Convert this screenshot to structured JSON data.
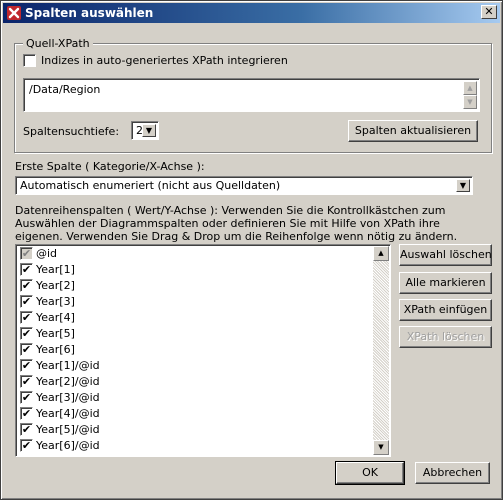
{
  "window": {
    "title": "Spalten auswählen",
    "close_glyph": "✕"
  },
  "source_group": {
    "legend": "Quell-XPath",
    "integrate_indices_label": "Indizes in auto-generiertes XPath integrieren",
    "integrate_indices_checked": false,
    "xpath_value": "/Data/Region",
    "depth_label": "Spaltensuchtiefe:",
    "depth_value": "2",
    "refresh_button": "Spalten aktualisieren"
  },
  "first_column": {
    "label": "Erste Spalte ( Kategorie/X-Achse ):",
    "selected": "Automatisch enumeriert (nicht aus Quelldaten)"
  },
  "series": {
    "description": "Datenreihenspalten ( Wert/Y-Achse ): Verwenden Sie die Kontrollkästchen zum Auswählen der Diagrammspalten oder definieren Sie mit Hilfe von XPath ihre eigenen. Verwenden Sie Drag & Drop um die Reihenfolge wenn nötig zu ändern.",
    "items": [
      {
        "label": "@id",
        "checked": true,
        "disabled": true
      },
      {
        "label": "Year[1]",
        "checked": true
      },
      {
        "label": "Year[2]",
        "checked": true
      },
      {
        "label": "Year[3]",
        "checked": true
      },
      {
        "label": "Year[4]",
        "checked": true
      },
      {
        "label": "Year[5]",
        "checked": true
      },
      {
        "label": "Year[6]",
        "checked": true
      },
      {
        "label": "Year[1]/@id",
        "checked": true
      },
      {
        "label": "Year[2]/@id",
        "checked": true
      },
      {
        "label": "Year[3]/@id",
        "checked": true
      },
      {
        "label": "Year[4]/@id",
        "checked": true
      },
      {
        "label": "Year[5]/@id",
        "checked": true
      },
      {
        "label": "Year[6]/@id",
        "checked": true
      }
    ]
  },
  "side_buttons": {
    "clear_selection": "Auswahl löschen",
    "mark_all": "Alle markieren",
    "insert_xpath": "XPath einfügen",
    "delete_xpath": "XPath löschen"
  },
  "footer": {
    "ok": "OK",
    "cancel": "Abbrechen"
  },
  "icons": {
    "check": "✔",
    "arrow_up": "▲",
    "arrow_down": "▼"
  },
  "colors": {
    "titlebar_start": "#0a246a",
    "titlebar_end": "#a6caf0",
    "dialog_bg": "#d4d0c8",
    "app_icon": "#c0272d"
  }
}
